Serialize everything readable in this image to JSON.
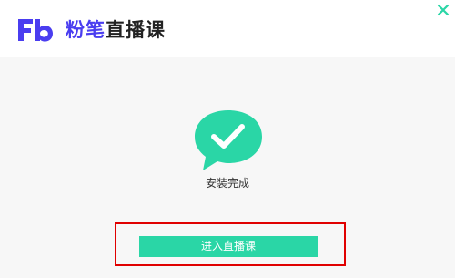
{
  "header": {
    "logo_icon": "fb-logo-icon",
    "brand_name": "粉笔",
    "product_name": "直播课",
    "close_icon": "close-icon"
  },
  "main": {
    "status_icon": "chat-bubble-checkmark-icon",
    "status_text": "安装完成",
    "enter_button_label": "进入直播课"
  },
  "colors": {
    "accent": "#2ad6a6",
    "logo_purple": "#4a3df0",
    "highlight_border": "#e00000",
    "header_bg": "#ffffff",
    "body_bg": "#f7f7f7"
  }
}
